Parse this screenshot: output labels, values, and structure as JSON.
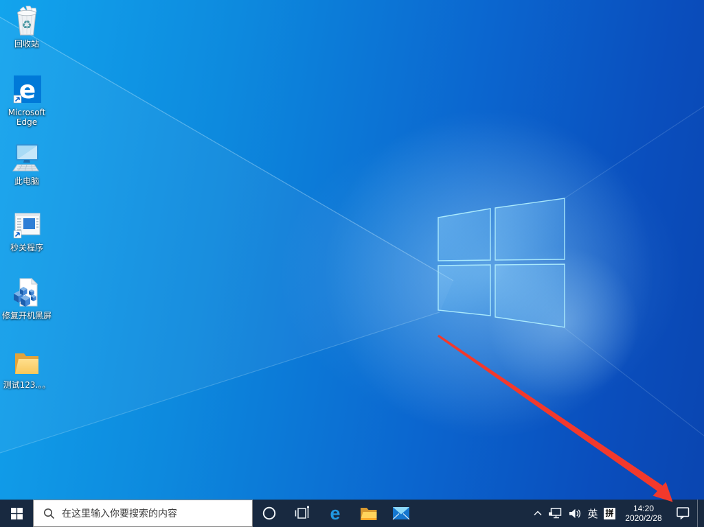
{
  "desktop": {
    "icons": [
      {
        "name": "recycle-bin",
        "label": "回收站"
      },
      {
        "name": "microsoft-edge",
        "label": "Microsoft Edge",
        "shortcut": true
      },
      {
        "name": "this-pc",
        "label": "此电脑"
      },
      {
        "name": "quick-close-program",
        "label": "秒关程序",
        "shortcut": true
      },
      {
        "name": "fix-boot-black-screen",
        "label": "修复开机黑屏"
      },
      {
        "name": "test-folder",
        "label": "测试123.。。"
      }
    ]
  },
  "taskbar": {
    "search": {
      "placeholder": "在这里输入你要搜索的内容"
    },
    "buttons": [
      {
        "name": "start"
      },
      {
        "name": "cortana"
      },
      {
        "name": "task-view"
      },
      {
        "name": "edge"
      },
      {
        "name": "file-explorer"
      },
      {
        "name": "mail"
      }
    ],
    "tray": {
      "icons": [
        "chevron-up",
        "ethernet",
        "volume",
        "action-center"
      ],
      "language": "英",
      "ime_mode": "拼",
      "time": "14:20",
      "date": "2020/2/28"
    }
  },
  "glyphs": {
    "edge": "e",
    "recycle": "♻"
  },
  "colors": {
    "taskbar": "#182940",
    "edge_tile": "#0079d8",
    "arrow": "#f2392c",
    "wallpaper_bright": "#12a4ed",
    "wallpaper_dark": "#0a45b0",
    "folder_front": "#ffd36b"
  }
}
